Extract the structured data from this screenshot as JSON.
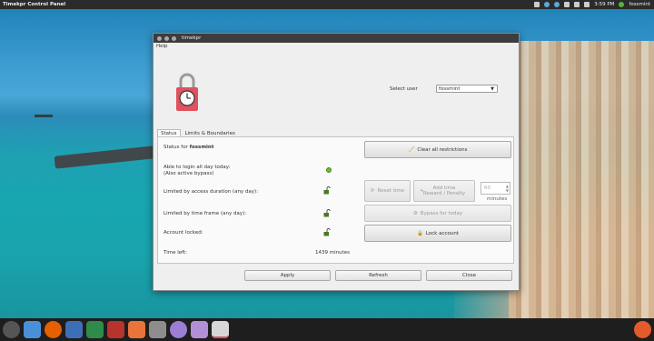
{
  "top_panel": {
    "app_title": "Timekpr Control Panel",
    "clock": "3:59 PM",
    "user": "fossmint"
  },
  "window": {
    "title": "timekpr",
    "menu": {
      "help": "Help"
    },
    "select_user_label": "Select user",
    "select_user_value": "fossmint",
    "tabs": [
      {
        "label": "Status"
      },
      {
        "label": "Limits & Boundaries"
      }
    ],
    "status": {
      "status_for_prefix": "Status for",
      "status_for_user": "fossmint",
      "login_all_day_line1": "Able to login all day today:",
      "login_all_day_line2": "(Also active bypass)",
      "limited_duration": "Limited by access duration (any day):",
      "limited_time_frame": "Limited by time frame (any day):",
      "account_locked": "Account locked:",
      "time_left_label": "Time left:",
      "time_left_value": "1439 minutes"
    },
    "buttons": {
      "clear_all": "Clear all restrictions",
      "reset_time": "Reset time",
      "add_time_line1": "Add time",
      "add_time_line2": "Reward / Penalty",
      "bypass_today": "Bypass for today",
      "lock_account": "Lock account",
      "minutes_value": "60",
      "minutes_unit": "minutes"
    },
    "bottom_buttons": {
      "apply": "Apply",
      "refresh": "Refresh",
      "close": "Close"
    }
  },
  "colors": {
    "lock_red": "#e0525e",
    "indicator_green": "#6bbf2f",
    "titlebar": "#3d3d3d",
    "panel_bar": "#2b2b2b"
  },
  "dock_icons": [
    "ubuntu-icon",
    "files-icon",
    "firefox-icon",
    "terminal-icon",
    "editor-icon",
    "scribus-icon",
    "app-store-icon",
    "calendar-icon",
    "search-icon",
    "gallery-icon",
    "timekpr-icon",
    "power-icon"
  ]
}
